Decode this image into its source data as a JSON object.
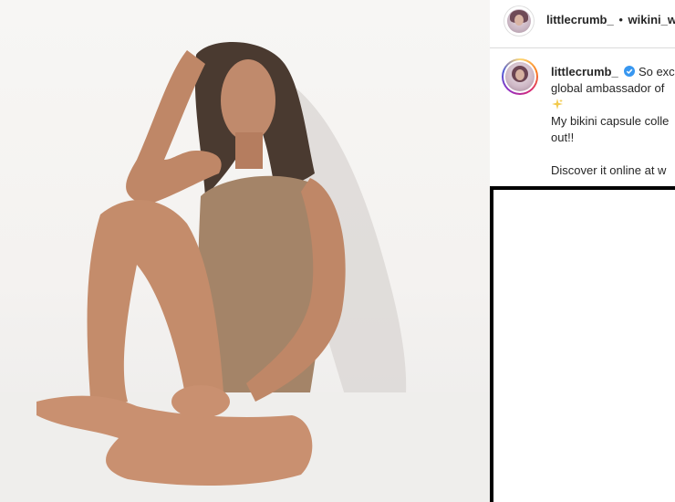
{
  "post": {
    "photo_alt": "photo",
    "header": {
      "username": "littlecrumb_",
      "separator": "•",
      "location": "wikini_w"
    },
    "caption": {
      "username": "littlecrumb_",
      "line1": "So exc",
      "line2": "global ambassador of",
      "line3": "My bikini capsule colle",
      "line4": "out!!",
      "line5": "Discover it online at w"
    },
    "colors": {
      "text": "#262626",
      "verified": "#3897f0",
      "divider": "#dbdbdb"
    }
  }
}
